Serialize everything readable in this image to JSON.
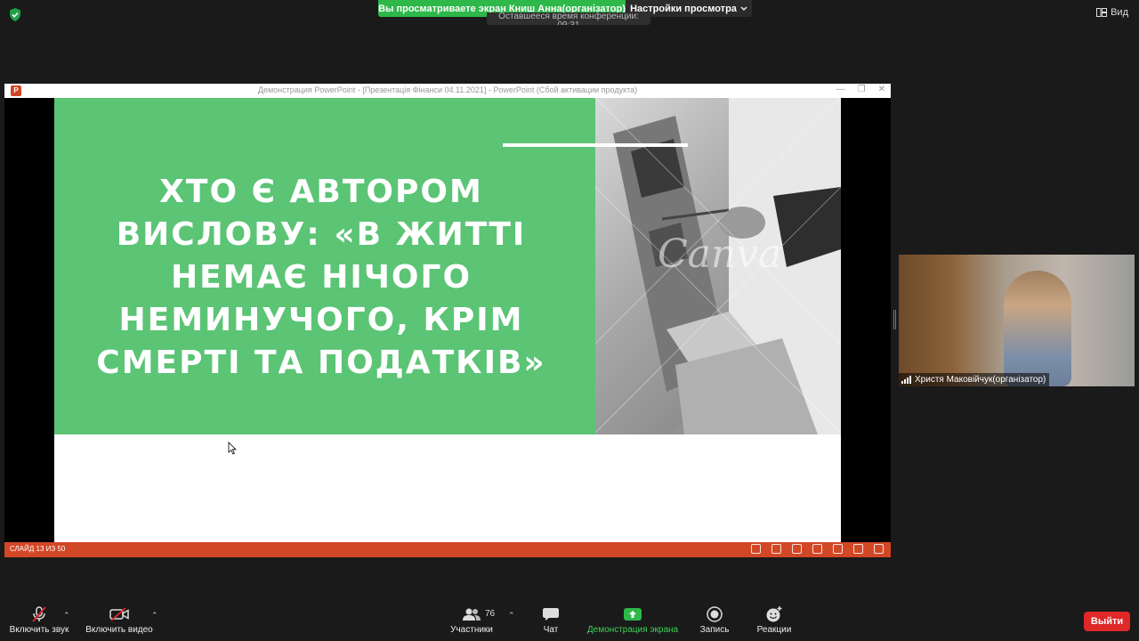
{
  "banner": {
    "viewing_text": "Вы просматриваете экран Книш Анна(організатор)",
    "view_settings_label": "Настройки просмотра",
    "timer_text": "Оставшееся время конференции: 09:31"
  },
  "view_button_label": "Вид",
  "ppt": {
    "window_title": "Демонстрация PowerPoint - [Презентація Фінанси 04.11.2021] - PowerPoint (Сбой активации продукта)",
    "status_text": "СЛАЙД 13 ИЗ 50"
  },
  "slide": {
    "text_lines": [
      "Хто є автором",
      "вислову: «В житті",
      "немає нічого",
      "неминучого, крім",
      "смерті та податків»"
    ],
    "watermark": "Canva"
  },
  "video": {
    "participant_name": "Христя Маковійчук(організатор)"
  },
  "toolbar": {
    "unmute_label": "Включить звук",
    "start_video_label": "Включить видео",
    "participants_label": "Участники",
    "participants_count": "76",
    "chat_label": "Чат",
    "share_screen_label": "Демонстрация экрана",
    "record_label": "Запись",
    "reactions_label": "Реакции",
    "leave_label": "Выйти"
  },
  "colors": {
    "banner_green": "#2eb84a",
    "slide_green": "#5bc475",
    "ppt_accent": "#d24726",
    "leave_red": "#e02828",
    "share_green": "#2eb84a"
  }
}
